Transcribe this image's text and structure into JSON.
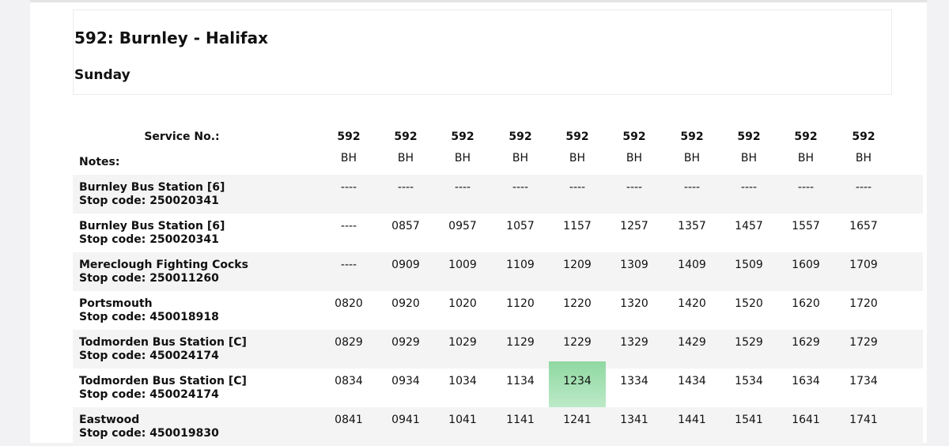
{
  "title": "592: Burnley - Halifax",
  "day": "Sunday",
  "service_label": "Service No.:",
  "notes_label": "Notes:",
  "services": [
    "592",
    "592",
    "592",
    "592",
    "592",
    "592",
    "592",
    "592",
    "592",
    "592"
  ],
  "notes": [
    "BH",
    "BH",
    "BH",
    "BH",
    "BH",
    "BH",
    "BH",
    "BH",
    "BH",
    "BH"
  ],
  "highlight_color": "#a8e2b6",
  "stops": [
    {
      "name": "Burnley Bus Station [6]",
      "code": "Stop code: 250020341",
      "times": [
        "----",
        "----",
        "----",
        "----",
        "----",
        "----",
        "----",
        "----",
        "----",
        "----"
      ]
    },
    {
      "name": "Burnley Bus Station [6]",
      "code": "Stop code: 250020341",
      "times": [
        "----",
        "0857",
        "0957",
        "1057",
        "1157",
        "1257",
        "1357",
        "1457",
        "1557",
        "1657"
      ]
    },
    {
      "name": "Mereclough Fighting Cocks",
      "code": "Stop code: 250011260",
      "times": [
        "----",
        "0909",
        "1009",
        "1109",
        "1209",
        "1309",
        "1409",
        "1509",
        "1609",
        "1709"
      ]
    },
    {
      "name": "Portsmouth",
      "code": "Stop code: 450018918",
      "times": [
        "0820",
        "0920",
        "1020",
        "1120",
        "1220",
        "1320",
        "1420",
        "1520",
        "1620",
        "1720"
      ]
    },
    {
      "name": "Todmorden Bus Station [C]",
      "code": "Stop code: 450024174",
      "times": [
        "0829",
        "0929",
        "1029",
        "1129",
        "1229",
        "1329",
        "1429",
        "1529",
        "1629",
        "1729"
      ]
    },
    {
      "name": "Todmorden Bus Station [C]",
      "code": "Stop code: 450024174",
      "times": [
        "0834",
        "0934",
        "1034",
        "1134",
        "1234",
        "1334",
        "1434",
        "1534",
        "1634",
        "1734"
      ]
    },
    {
      "name": "Eastwood",
      "code": "Stop code: 450019830",
      "times": [
        "0841",
        "0941",
        "1041",
        "1141",
        "1241",
        "1341",
        "1441",
        "1541",
        "1641",
        "1741"
      ]
    }
  ]
}
